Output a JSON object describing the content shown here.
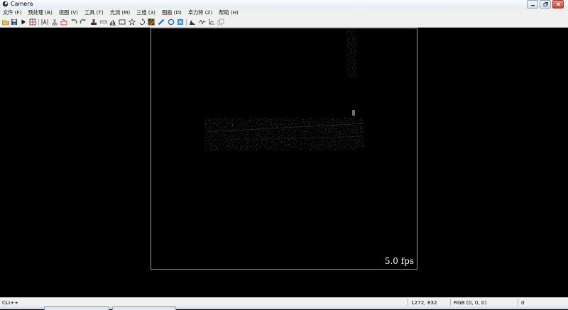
{
  "window": {
    "title": "Camera"
  },
  "menu": [
    "文件 (F)",
    "预处理 (B)",
    "视图 (V)",
    "工具 (T)",
    "光测 (M)",
    "三维 (3)",
    "图画 (D)",
    "卓力特 (Z)",
    "帮助 (H)"
  ],
  "toolbar_icons": [
    "open-folder-icon",
    "save-icon",
    "play-icon",
    "grid-icon",
    "text-measure-icon",
    "scissors-icon",
    "cut-icon",
    "undo-icon",
    "redo-icon",
    "stamp-icon",
    "ruler-icon",
    "histogram-bars-icon",
    "rectangle-icon",
    "star-icon",
    "rotate-icon",
    "color-pattern-icon",
    "line-tool-icon",
    "circle-icon",
    "crop-icon",
    "histogram-icon",
    "waveform-icon",
    "axes-icon",
    "copy-icon"
  ],
  "viewer": {
    "fps_label": "5.0 fps"
  },
  "status": {
    "mode": "CLI++",
    "coords": "1272, 832",
    "rgb": "RGB (0, 0, 0)",
    "value": "0"
  },
  "colors": {
    "background": "#000000",
    "chrome": "#f0f0f0",
    "frame_border": "#9a9a9a"
  }
}
